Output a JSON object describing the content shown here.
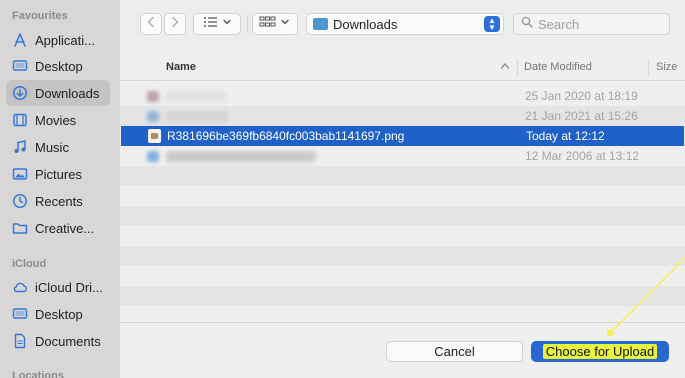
{
  "sidebar": {
    "sections": [
      {
        "label": "Favourites"
      },
      {
        "label": "iCloud"
      },
      {
        "label": "Locations"
      }
    ],
    "items": [
      {
        "label": "Applicati...",
        "icon": "applications-icon"
      },
      {
        "label": "Desktop",
        "icon": "desktop-icon"
      },
      {
        "label": "Downloads",
        "icon": "downloads-icon",
        "active": true
      },
      {
        "label": "Movies",
        "icon": "movies-icon"
      },
      {
        "label": "Music",
        "icon": "music-icon"
      },
      {
        "label": "Pictures",
        "icon": "pictures-icon"
      },
      {
        "label": "Recents",
        "icon": "recents-icon"
      },
      {
        "label": "Creative...",
        "icon": "folder-icon"
      },
      {
        "label": "iCloud Dri...",
        "icon": "icloud-icon"
      },
      {
        "label": "Desktop",
        "icon": "desktop-icon"
      },
      {
        "label": "Documents",
        "icon": "documents-icon"
      }
    ]
  },
  "toolbar": {
    "back_icon": "chevron-left-icon",
    "forward_icon": "chevron-right-icon",
    "view_list_icon": "list-view-icon",
    "view_grid_icon": "grid-view-icon",
    "path": "Downloads",
    "search_placeholder": "Search"
  },
  "table": {
    "headers": {
      "name": "Name",
      "date": "Date Modified",
      "size": "Size"
    },
    "rows": [
      {
        "name": "",
        "date": "25 Jan 2020 at 18:19",
        "blurred": true
      },
      {
        "name": "",
        "date": "21 Jan 2021 at 15:26",
        "blurred": true
      },
      {
        "name": "R381696be369fb6840fc003bab1141697.png",
        "date": "Today at 12:12",
        "selected": true
      },
      {
        "name": "",
        "date": "12 Mar 2006 at 13:12",
        "blurred": true
      }
    ]
  },
  "footer": {
    "cancel_label": "Cancel",
    "choose_label": "Choose for Upload"
  },
  "colors": {
    "selection": "#1f60c9",
    "primary_button": "#2968d0",
    "highlight": "#e8f53a",
    "annotation_line": "#f3f05a"
  }
}
